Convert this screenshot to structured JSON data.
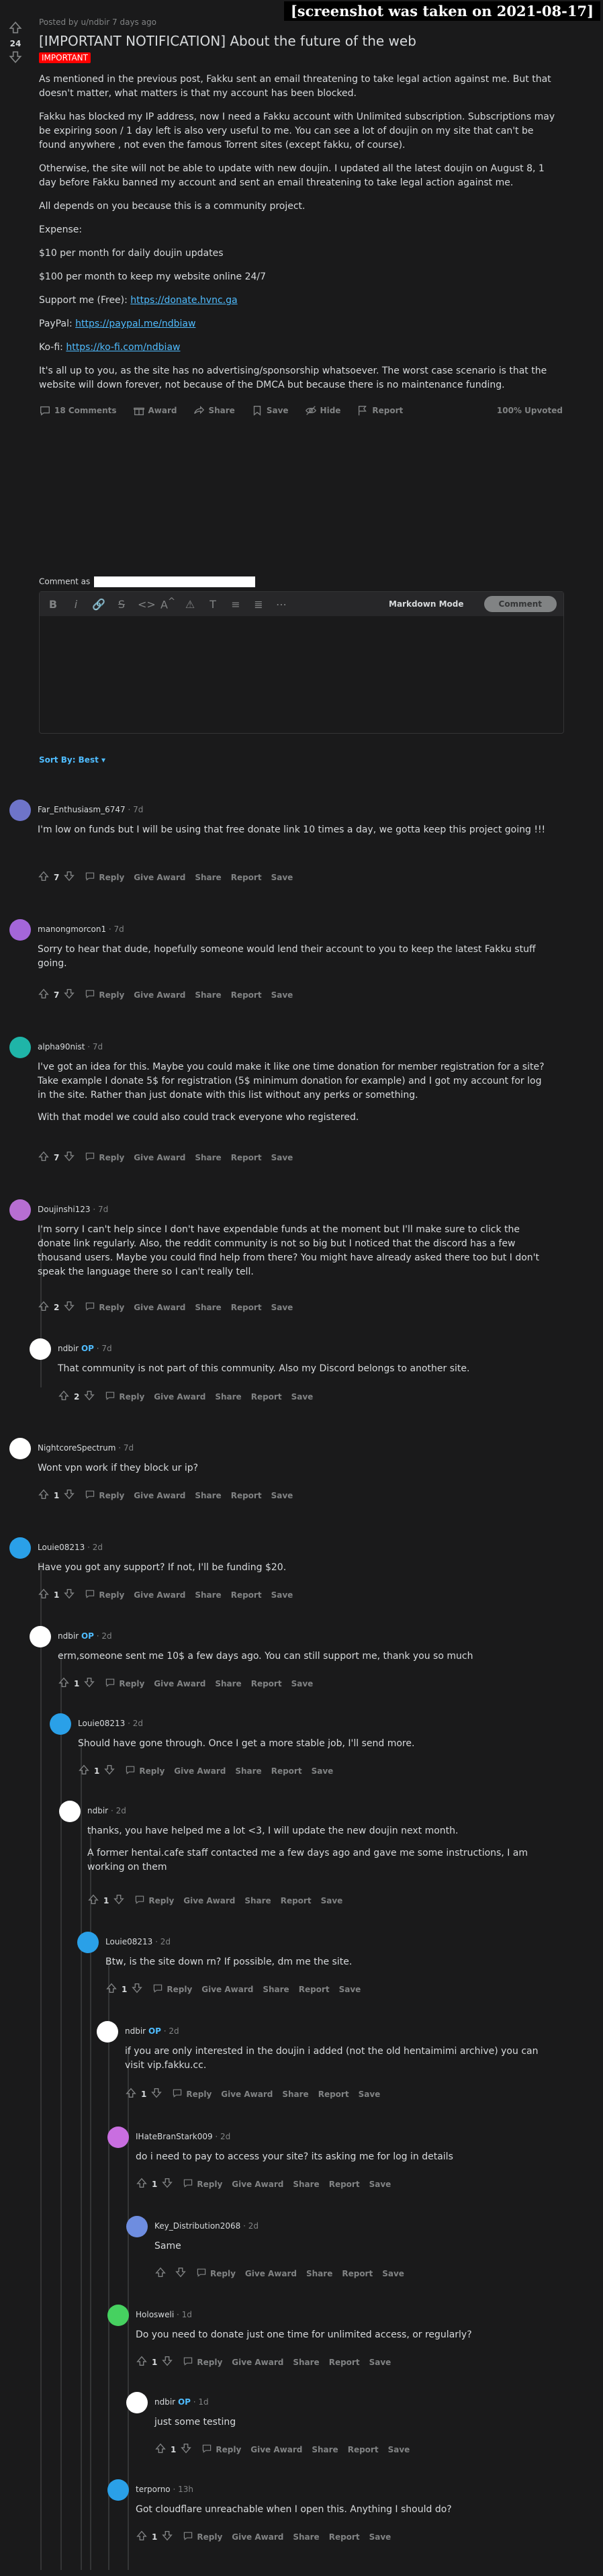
{
  "watermark": "[screenshot was taken on 2021-08-17]",
  "post": {
    "score": "24",
    "posted_by": "Posted by u/ndbir 7 days ago",
    "title": "[IMPORTANT NOTIFICATION] About the future of the web",
    "flair": "IMPORTANT",
    "paragraphs": [
      "As mentioned in the previous post, Fakku sent an email threatening to take legal action against me. But that doesn't matter, what matters is that my account has been blocked.",
      "Fakku has blocked my IP address, now I need a Fakku account with Unlimited subscription. Subscriptions may be expiring soon / 1 day left is also very useful to me. You can see a lot of doujin on my site that can't be found anywhere , not even the famous Torrent sites (except fakku, of course).",
      "Otherwise, the site will not be able to update with new doujin. I updated all the latest doujin on August 8, 1 day before Fakku banned my account and sent an email threatening to take legal action against me.",
      "All depends on you because this is a community project.",
      "Expense:",
      "$10 per month for daily doujin updates",
      "$100 per month to keep my website online 24/7"
    ],
    "support_label": "Support me (Free): ",
    "support_link": "https://donate.hvnc.ga",
    "paypal_label": "PayPal: ",
    "paypal_link": "https://paypal.me/ndbiaw",
    "kofi_label": "Ko-fi: ",
    "kofi_link": "https://ko-fi.com/ndbiaw",
    "closing": "It's all up to you, as the site has no advertising/sponsorship whatsoever. The worst case scenario is that the website will down forever, not because of the DMCA but because there is no maintenance funding.",
    "actions": {
      "comments": "18 Comments",
      "award": "Award",
      "share": "Share",
      "save": "Save",
      "hide": "Hide",
      "report": "Report",
      "upvoted": "100% Upvoted"
    }
  },
  "composer": {
    "comment_as": "Comment as",
    "markdown_mode": "Markdown Mode",
    "comment_button": "Comment"
  },
  "sort_label": "Sort By: Best",
  "labels": {
    "reply": "Reply",
    "give_award": "Give Award",
    "share": "Share",
    "report": "Report",
    "save": "Save",
    "op": "OP"
  },
  "comments": [
    {
      "user": "Far_Enthusiasm_6747",
      "age": "· 7d",
      "op": false,
      "votes": "7",
      "avatar_color": "#6e74c9",
      "text": [
        "I'm low on funds but I will be using that free donate link 10 times a day, we gotta keep this project going !!!"
      ]
    },
    {
      "user": "manongmorcon1",
      "age": "· 7d",
      "op": false,
      "votes": "7",
      "avatar_color": "#a466d9",
      "text": [
        "Sorry to hear that dude, hopefully someone would lend their account to you to keep the latest Fakku stuff going."
      ]
    },
    {
      "user": "alpha90nist",
      "age": "· 7d",
      "op": false,
      "votes": "7",
      "avatar_color": "#1fb5a8",
      "text": [
        "I've got an idea for this. Maybe you could make it like one time donation for member registration for a site? Take example I donate 5$ for registration (5$ minimum donation for example) and I got my account for log in the site. Rather than just donate with this list without any perks or something.",
        "With that model we could also could track everyone who registered."
      ]
    },
    {
      "user": "Doujinshi123",
      "age": "· 7d",
      "op": false,
      "votes": "2",
      "avatar_color": "#b76ed2",
      "text": [
        "I'm sorry I can't help since I don't have expendable funds at the moment but I'll make sure to click the donate link regularly. Also, the reddit community is not so big but I noticed that the discord has a few thousand users. Maybe you could find help from there? You might have already asked there too but I don't speak the language there so I can't really tell."
      ]
    },
    {
      "user": "ndbir",
      "age": "· 7d",
      "op": true,
      "votes": "2",
      "avatar_color": "#ffffff",
      "text": [
        "That community is not part of this community. Also my Discord belongs to another site."
      ]
    },
    {
      "user": "NightcoreSpectrum",
      "age": "· 7d",
      "op": false,
      "votes": "1",
      "avatar_color": "#ffffff",
      "text": [
        "Wont vpn work if they block ur ip?"
      ]
    },
    {
      "user": "Louie08213",
      "age": "· 2d",
      "op": false,
      "votes": "1",
      "avatar_color": "#2aa0e8",
      "text": [
        "Have you got any support? If not, I'll be funding $20."
      ]
    },
    {
      "user": "ndbir",
      "age": "· 2d",
      "op": true,
      "votes": "1",
      "avatar_color": "#ffffff",
      "text": [
        "erm,someone sent me 10$ a few days ago. You can still support me, thank you so much"
      ]
    },
    {
      "user": "Louie08213",
      "age": "· 2d",
      "op": false,
      "votes": "1",
      "avatar_color": "#2aa0e8",
      "text": [
        "Should have gone through. Once I get a more stable job, I'll send more."
      ]
    },
    {
      "user": "ndbir",
      "age": "· 2d",
      "op": false,
      "votes": "1",
      "avatar_color": "#ffffff",
      "text": [
        "thanks, you have helped me a lot <3, I will update the new doujin next month.",
        "A former hentai.cafe staff contacted me a few days ago and gave me some instructions, I am working on them"
      ]
    },
    {
      "user": "Louie08213",
      "age": "· 2d",
      "op": false,
      "votes": "1",
      "avatar_color": "#2aa0e8",
      "text": [
        "Btw, is the site down rn? If possible, dm me the site."
      ]
    },
    {
      "user": "ndbir",
      "age": "· 2d",
      "op": true,
      "votes": "1",
      "avatar_color": "#ffffff",
      "text": [
        "if you are only interested in the doujin i added (not the old hentaimimi archive) you can visit vip.fakku.cc."
      ]
    },
    {
      "user": "IHateBranStark009",
      "age": "· 2d",
      "op": false,
      "votes": "1",
      "avatar_color": "#c96ee0",
      "text": [
        "do i need to pay to access your site? its asking me for log in details"
      ]
    },
    {
      "user": "Key_Distribution2068",
      "age": "· 2d",
      "op": false,
      "votes": "",
      "avatar_color": "#6e8de0",
      "text": [
        "Same"
      ]
    },
    {
      "user": "Holosweli",
      "age": "· 1d",
      "op": false,
      "votes": "1",
      "avatar_color": "#46d160",
      "text": [
        "Do you need to donate just one time for unlimited access, or regularly?"
      ]
    },
    {
      "user": "ndbir",
      "age": "· 1d",
      "op": true,
      "votes": "1",
      "avatar_color": "#ffffff",
      "text": [
        "just some testing"
      ]
    },
    {
      "user": "terporno",
      "age": "· 13h",
      "op": false,
      "votes": "1",
      "avatar_color": "#2aa0e8",
      "text": [
        "Got cloudflare unreachable when I open this. Anything I should do?"
      ]
    }
  ]
}
